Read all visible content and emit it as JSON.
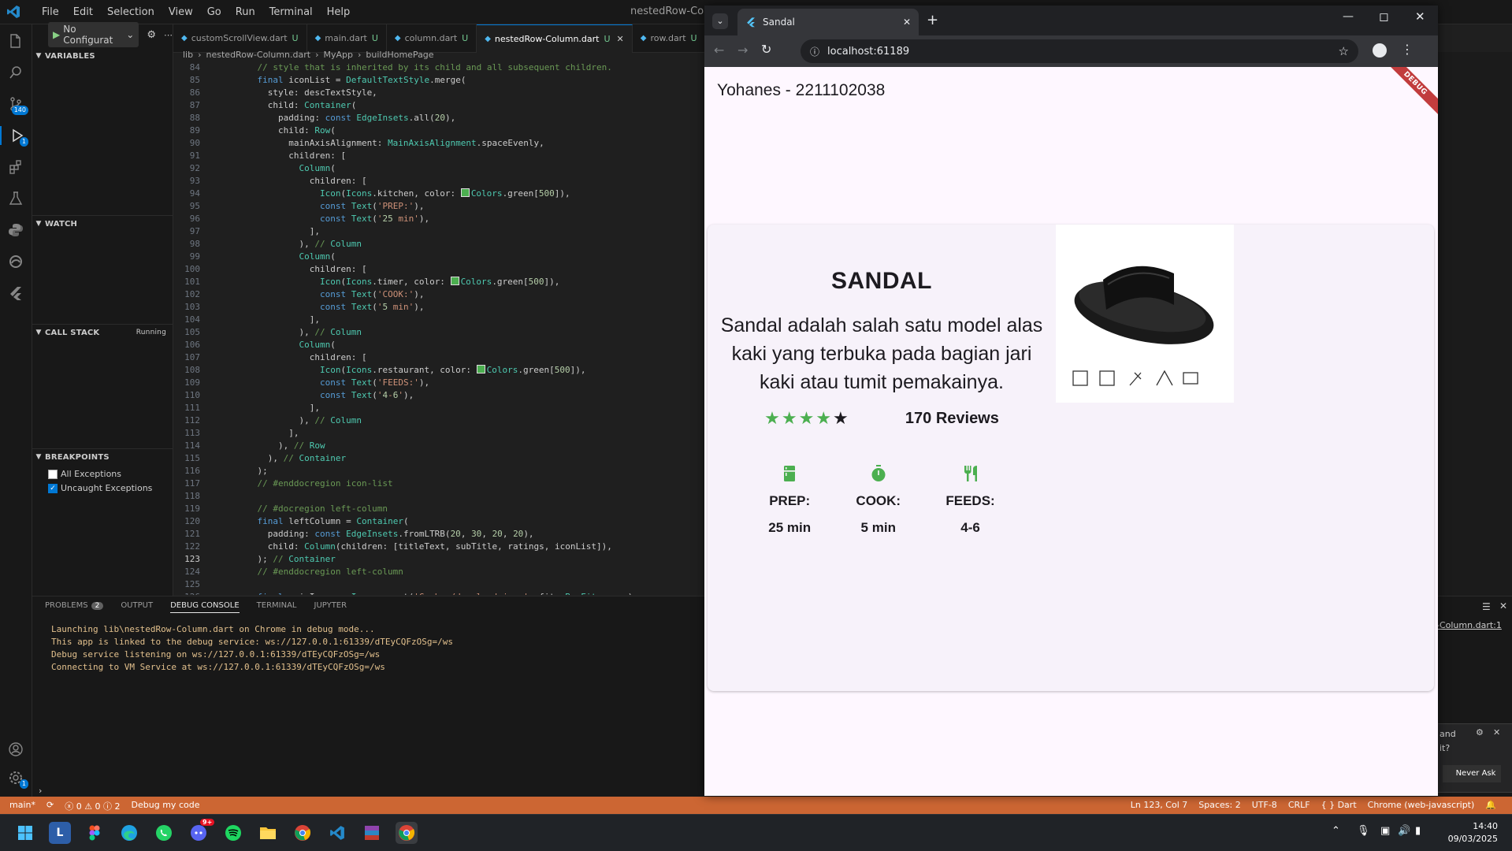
{
  "vscode": {
    "menu": [
      "File",
      "Edit",
      "Selection",
      "View",
      "Go",
      "Run",
      "Terminal",
      "Help"
    ],
    "window_title": "nestedRow-Colum",
    "run_config": "No Configurat",
    "sections": {
      "variables": "VARIABLES",
      "watch": "WATCH",
      "call_stack": "CALL STACK",
      "call_stack_status": "Running",
      "breakpoints": "BREAKPOINTS"
    },
    "breakpoints": [
      {
        "label": "All Exceptions",
        "checked": false
      },
      {
        "label": "Uncaught Exceptions",
        "checked": true
      }
    ],
    "activity_badges": {
      "source_control": "140",
      "run_debug": "1",
      "accounts_settings": "1"
    },
    "tabs": [
      {
        "label": "customScrollView.dart",
        "status": "U",
        "active": false
      },
      {
        "label": "main.dart",
        "status": "U",
        "active": false
      },
      {
        "label": "column.dart",
        "status": "U",
        "active": false
      },
      {
        "label": "nestedRow-Column.dart",
        "status": "U",
        "active": true
      },
      {
        "label": "row.dart",
        "status": "U",
        "active": false
      }
    ],
    "breadcrumb": [
      "lib",
      "nestedRow-Column.dart",
      "MyApp",
      "buildHomePage"
    ],
    "code_lines": [
      {
        "n": "84",
        "t": "    // style that is inherited by its child and all subsequent children."
      },
      {
        "n": "85",
        "t": "    final iconList = DefaultTextStyle.merge("
      },
      {
        "n": "86",
        "t": "      style: descTextStyle,"
      },
      {
        "n": "87",
        "t": "      child: Container("
      },
      {
        "n": "88",
        "t": "        padding: const EdgeInsets.all(20),"
      },
      {
        "n": "89",
        "t": "        child: Row("
      },
      {
        "n": "90",
        "t": "          mainAxisAlignment: MainAxisAlignment.spaceEvenly,"
      },
      {
        "n": "91",
        "t": "          children: ["
      },
      {
        "n": "92",
        "t": "            Column("
      },
      {
        "n": "93",
        "t": "              children: ["
      },
      {
        "n": "94",
        "t": "                Icon(Icons.kitchen, color: ■Colors.green[500]),"
      },
      {
        "n": "95",
        "t": "                const Text('PREP:'),"
      },
      {
        "n": "96",
        "t": "                const Text('25 min'),"
      },
      {
        "n": "97",
        "t": "              ],"
      },
      {
        "n": "98",
        "t": "            ), // Column"
      },
      {
        "n": "99",
        "t": "            Column("
      },
      {
        "n": "100",
        "t": "              children: ["
      },
      {
        "n": "101",
        "t": "                Icon(Icons.timer, color: ■Colors.green[500]),"
      },
      {
        "n": "102",
        "t": "                const Text('COOK:'),"
      },
      {
        "n": "103",
        "t": "                const Text('5 min'),"
      },
      {
        "n": "104",
        "t": "              ],"
      },
      {
        "n": "105",
        "t": "            ), // Column"
      },
      {
        "n": "106",
        "t": "            Column("
      },
      {
        "n": "107",
        "t": "              children: ["
      },
      {
        "n": "108",
        "t": "                Icon(Icons.restaurant, color: ■Colors.green[500]),"
      },
      {
        "n": "109",
        "t": "                const Text('FEEDS:'),"
      },
      {
        "n": "110",
        "t": "                const Text('4-6'),"
      },
      {
        "n": "111",
        "t": "              ],"
      },
      {
        "n": "112",
        "t": "            ), // Column"
      },
      {
        "n": "113",
        "t": "          ],"
      },
      {
        "n": "114",
        "t": "        ), // Row"
      },
      {
        "n": "115",
        "t": "      ), // Container"
      },
      {
        "n": "116",
        "t": "    );"
      },
      {
        "n": "117",
        "t": "    // #enddocregion icon-list"
      },
      {
        "n": "118",
        "t": ""
      },
      {
        "n": "119",
        "t": "    // #docregion left-column"
      },
      {
        "n": "120",
        "t": "    final leftColumn = Container("
      },
      {
        "n": "121",
        "t": "      padding: const EdgeInsets.fromLTRB(20, 30, 20, 20),"
      },
      {
        "n": "122",
        "t": "      child: Column(children: [titleText, subTitle, ratings, iconList]),"
      },
      {
        "n": "123",
        "t": "    ); // Container"
      },
      {
        "n": "124",
        "t": "    // #enddocregion left-column"
      },
      {
        "n": "125",
        "t": ""
      },
      {
        "n": "126",
        "t": "    final mainImage = Image.asset('Gambar/download.jpeg', fit: BoxFit.cover);"
      }
    ],
    "panel_tabs": [
      "PROBLEMS",
      "OUTPUT",
      "DEBUG CONSOLE",
      "TERMINAL",
      "JUPYTER"
    ],
    "problems_count": "2",
    "console_lines": [
      "Launching lib\\nestedRow-Column.dart on Chrome in debug mode...",
      "This app is linked to the debug service: ws://127.0.0.1:61339/dTEyCQFzOSg=/ws",
      "Debug service listening on ws://127.0.0.1:61339/dTEyCQFzOSg=/ws",
      "Connecting to VM Service at ws://127.0.0.1:61339/dTEyCQFzOSg=/ws"
    ],
    "panel_right_link": "-Column.dart:1",
    "toast": {
      "text1": "and",
      "text2": "it?",
      "button": "Never Ask"
    },
    "status": {
      "branch": "main*",
      "problems": "ⓧ 0 ⚠ 0 ⓘ 2",
      "debug": "Debug my code",
      "position": "Ln 123, Col 7",
      "spaces": "Spaces: 2",
      "encoding": "UTF-8",
      "eol": "CRLF",
      "language": "{ } Dart",
      "device": "Chrome (web-javascript)"
    }
  },
  "chrome": {
    "tab_title": "Sandal",
    "url": "localhost:61189"
  },
  "app": {
    "appbar_title": "Yohanes - 2211102038",
    "debug_banner": "DEBUG",
    "title": "SANDAL",
    "subtitle": "Sandal adalah salah satu model alas kaki yang terbuka pada bagian jari kaki atau tumit pemakainya.",
    "stars": {
      "filled": 4,
      "total": 5,
      "color": "#4caf50"
    },
    "reviews": "170 Reviews",
    "icon_list": [
      {
        "icon": "kitchen-icon",
        "label": "PREP:",
        "value": "25 min"
      },
      {
        "icon": "timer-icon",
        "label": "COOK:",
        "value": "5 min"
      },
      {
        "icon": "restaurant-icon",
        "label": "FEEDS:",
        "value": "4-6"
      }
    ],
    "accent_color": "#4caf50"
  },
  "taskbar": {
    "time": "14:40",
    "date": "09/03/2025",
    "discord_badge": "9+"
  }
}
